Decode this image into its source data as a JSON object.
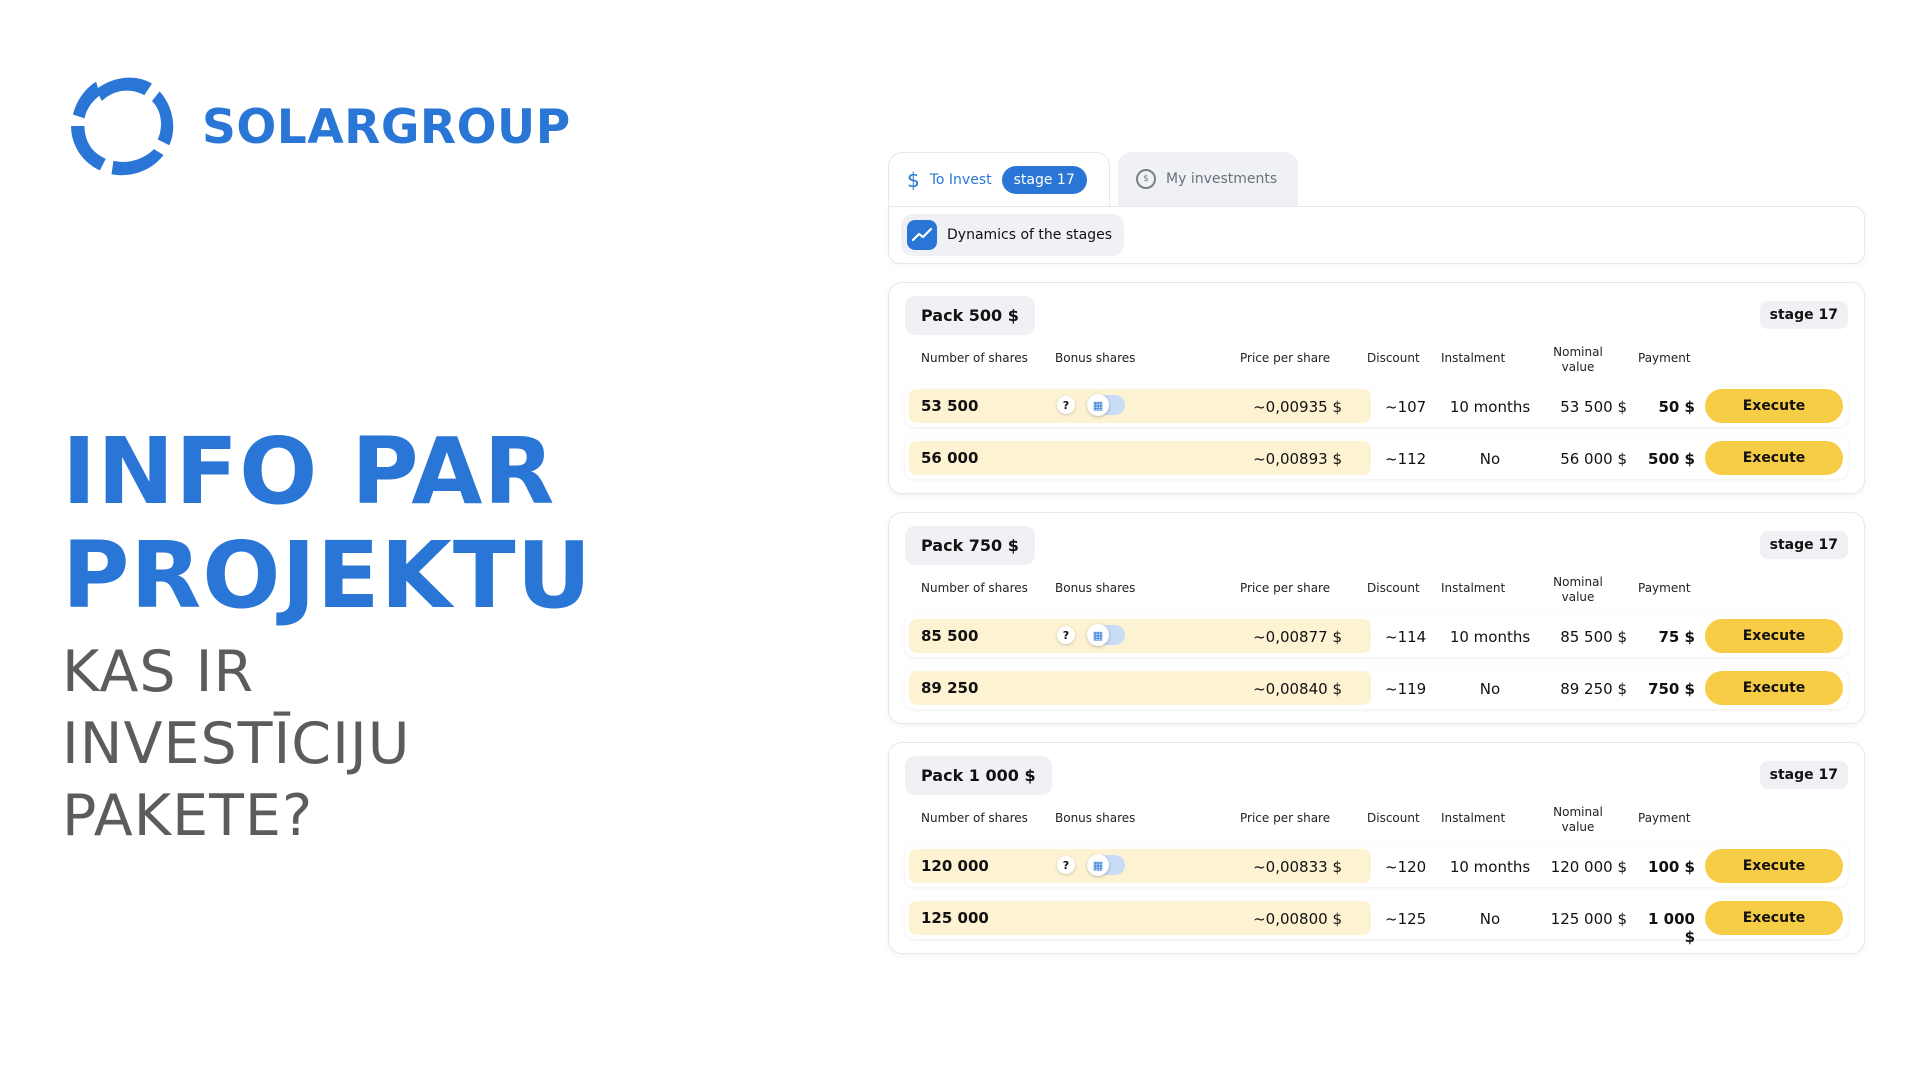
{
  "brand": {
    "name": "SOLARGROUP",
    "color": "#2a76d6"
  },
  "hero": {
    "title_line1": "INFO PAR",
    "title_line2": "PROJEKTU",
    "sub_line1": "KAS IR",
    "sub_line2": "INVESTĪCIJU",
    "sub_line3": "PAKETE?"
  },
  "tabs": {
    "invest_label": "To Invest",
    "invest_stage": "stage 17",
    "mine_label": "My investments"
  },
  "dynamics": {
    "label": "Dynamics of the stages"
  },
  "columns": {
    "shares": "Number of shares",
    "bonus": "Bonus shares",
    "price": "Price per share",
    "discount": "Discount",
    "instalment": "Instalment",
    "nominal_line1": "Nominal",
    "nominal_line2": "value",
    "payment": "Payment"
  },
  "execute_label": "Execute",
  "bonus_question": "?",
  "packs": [
    {
      "title": "Pack 500 $",
      "stage": "stage 17",
      "rows": [
        {
          "shares": "53 500",
          "price": "~0,00935 $",
          "discount": "~107",
          "instalment": "10 months",
          "nominal": "53 500 $",
          "payment": "50 $"
        },
        {
          "shares": "56 000",
          "price": "~0,00893 $",
          "discount": "~112",
          "instalment": "No",
          "nominal": "56 000 $",
          "payment": "500 $"
        }
      ]
    },
    {
      "title": "Pack 750 $",
      "stage": "stage 17",
      "rows": [
        {
          "shares": "85 500",
          "price": "~0,00877 $",
          "discount": "~114",
          "instalment": "10 months",
          "nominal": "85 500 $",
          "payment": "75 $"
        },
        {
          "shares": "89 250",
          "price": "~0,00840 $",
          "discount": "~119",
          "instalment": "No",
          "nominal": "89 250 $",
          "payment": "750 $"
        }
      ]
    },
    {
      "title": "Pack 1 000 $",
      "stage": "stage 17",
      "rows": [
        {
          "shares": "120 000",
          "price": "~0,00833 $",
          "discount": "~120",
          "instalment": "10 months",
          "nominal": "120 000 $",
          "payment": "100 $"
        },
        {
          "shares": "125 000",
          "price": "~0,00800 $",
          "discount": "~125",
          "instalment": "No",
          "nominal": "125 000 $",
          "payment": "1 000 $"
        }
      ]
    }
  ]
}
